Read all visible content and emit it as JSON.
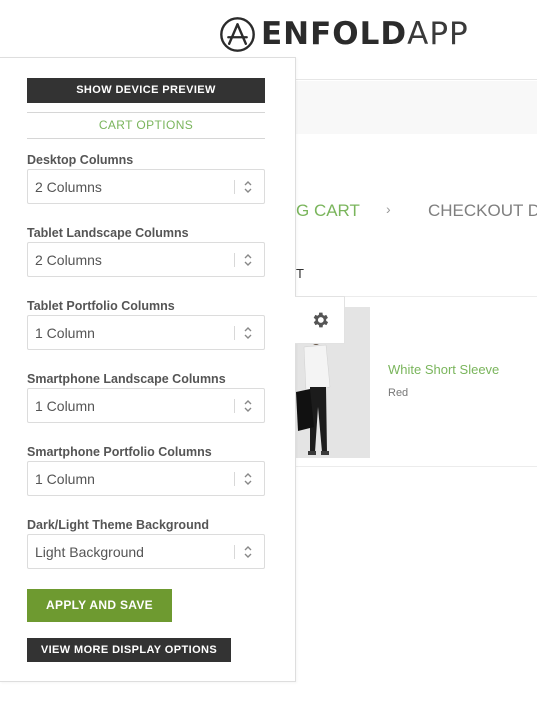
{
  "header": {
    "logo_bold": "ENFOLD",
    "logo_light": "APP"
  },
  "checkout_steps": {
    "cart": "G CART",
    "separator": "›",
    "checkout": "CHECKOUT D"
  },
  "cart_table": {
    "header_fragment": "T",
    "items": [
      {
        "title": "White Short Sleeve",
        "variant": "Red"
      }
    ]
  },
  "options_panel": {
    "preview_button": "SHOW DEVICE PREVIEW",
    "section_title": "CART OPTIONS",
    "fields": [
      {
        "label": "Desktop Columns",
        "value": "2 Columns"
      },
      {
        "label": "Tablet Landscape Columns",
        "value": "2 Columns"
      },
      {
        "label": "Tablet Portfolio Columns",
        "value": "1 Column"
      },
      {
        "label": "Smartphone Landscape Columns",
        "value": "1 Column"
      },
      {
        "label": "Smartphone Portfolio Columns",
        "value": "1 Column"
      },
      {
        "label": "Dark/Light Theme Background",
        "value": "Light Background"
      }
    ],
    "apply_button": "APPLY AND SAVE",
    "more_button": "VIEW MORE DISPLAY OPTIONS"
  },
  "icons": {
    "logo": "app-store-a-icon",
    "settings": "gear-icon",
    "select_arrows": "up-down-chevron-icon"
  },
  "colors": {
    "accent_green": "#7ab55c",
    "apply_green": "#6e9a30",
    "dark_button": "#333333"
  }
}
